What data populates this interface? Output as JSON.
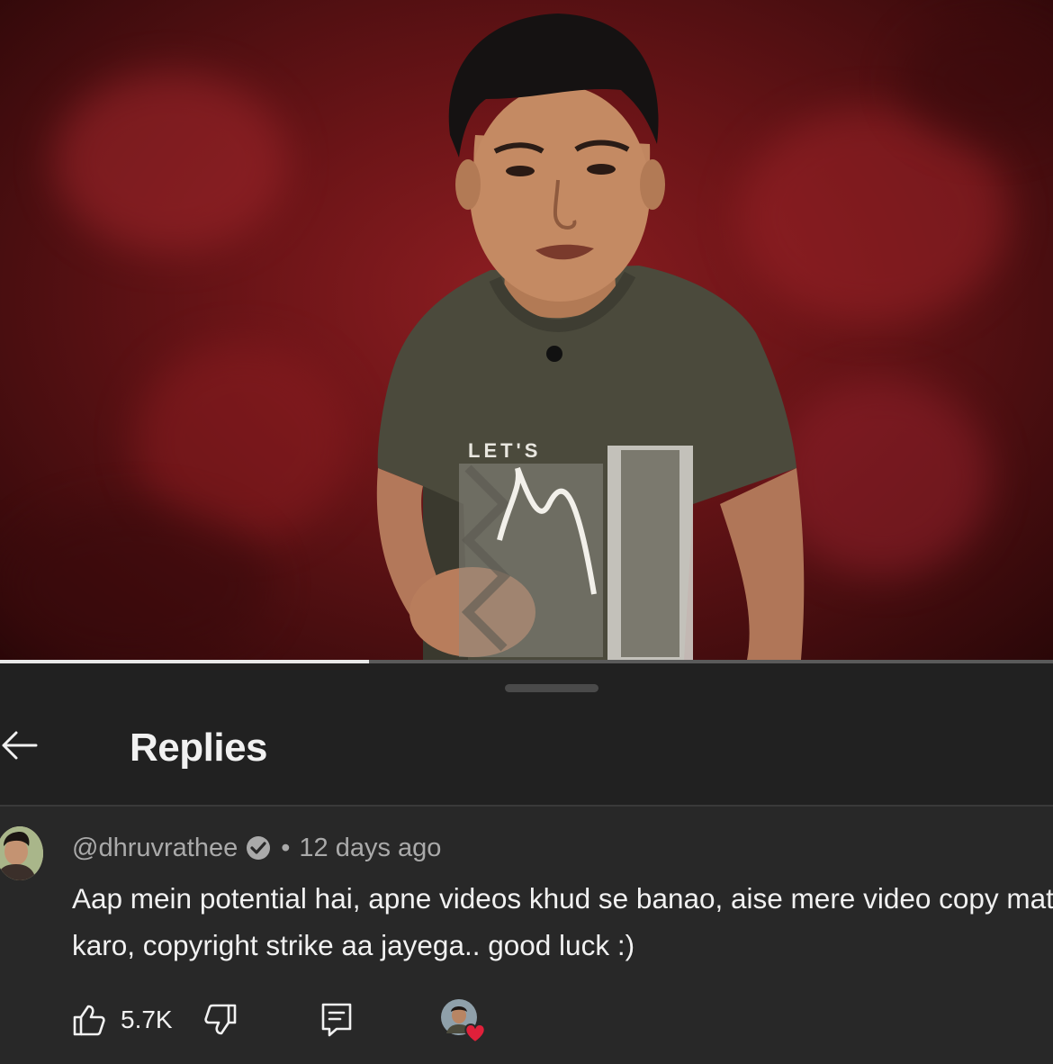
{
  "header": {
    "title": "Replies"
  },
  "video": {
    "progress": 0.35,
    "shirt_text": "LET'S"
  },
  "comment": {
    "author": "@dhruvrathee",
    "verified": true,
    "separator": "•",
    "time": "12 days ago",
    "text": "Aap mein potential hai, apne videos khud se banao, aise mere video copy mat karo, copyright strike aa jayega.. good luck :)",
    "likes": "5.7K"
  },
  "icons": {
    "back": "arrow-left-icon",
    "verified": "verified-check-icon",
    "like": "thumbs-up-icon",
    "dislike": "thumbs-down-icon",
    "reply": "reply-comment-icon",
    "heart": "creator-heart-icon"
  },
  "colors": {
    "background": "#212121",
    "panel": "#282828",
    "text": "#f1f1f1",
    "secondary": "#aaaaaa",
    "heart": "#e0203a"
  }
}
